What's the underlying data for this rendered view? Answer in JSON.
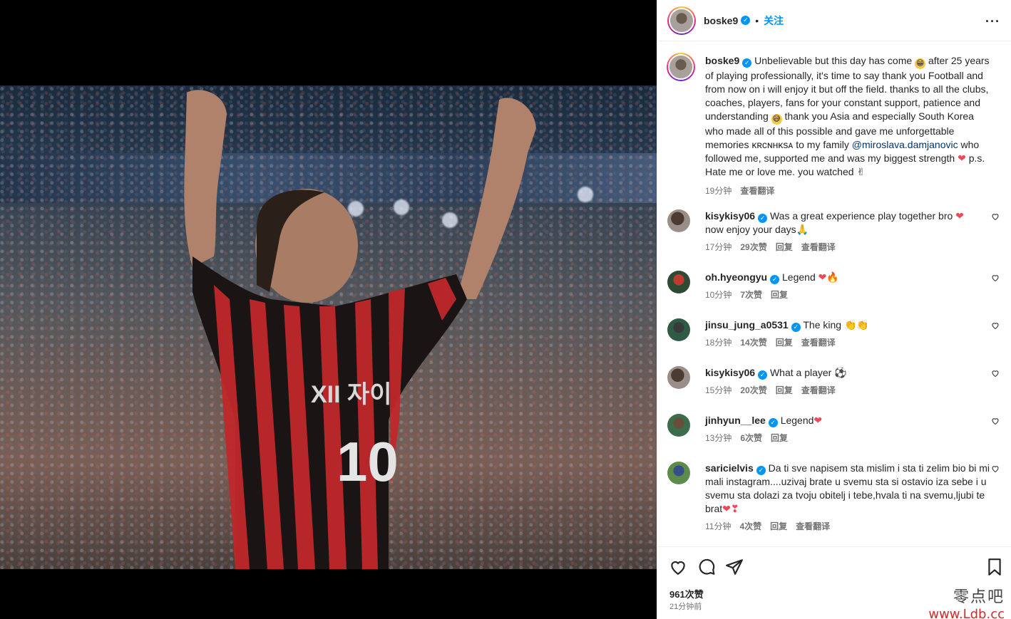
{
  "post": {
    "username": "boske9",
    "follow_label": "关注",
    "caption": {
      "text_1": "Unbelievable but this day has come",
      "text_2": "after 25 years of playing professionally, it's time to say thank you Football and from now on i will enjoy it but off the field. thanks to all the clubs, coaches, players, fans for your constant support, patience and understanding",
      "text_3": "thank you Asia and especially South Korea who made all of this possible and gave me unforgettable memories ᴋʀᴄɴʜᴋsᴀ to my family",
      "mention": "@miroslava.damjanovic",
      "text_4": "who followed me, supported me and was my biggest strength",
      "text_5": "p.s. Hate me or love me. you watched",
      "time": "19分钟",
      "translate": "查看翻译"
    }
  },
  "comments": [
    {
      "user": "kisykisy06",
      "text": "Was a great experience play together bro",
      "text2": "now enjoy your days",
      "time": "17分钟",
      "likes": "29次赞",
      "reply": "回复",
      "translate": "查看翻译"
    },
    {
      "user": "oh.hyeongyu",
      "text": "Legend",
      "time": "10分钟",
      "likes": "7次赞",
      "reply": "回复"
    },
    {
      "user": "jinsu_jung_a0531",
      "text": "The king",
      "time": "18分钟",
      "likes": "14次赞",
      "reply": "回复",
      "translate": "查看翻译"
    },
    {
      "user": "kisykisy06",
      "text": "What a player",
      "time": "15分钟",
      "likes": "20次赞",
      "reply": "回复",
      "translate": "查看翻译"
    },
    {
      "user": "jinhyun__lee",
      "text": "Legend",
      "time": "13分钟",
      "likes": "6次赞",
      "reply": "回复"
    },
    {
      "user": "saricielvis",
      "text": "Da ti sve napisem sta mislim i sta ti zelim bio bi mi mali instagram....uzivaj brate u svemu sta si ostavio iza sebe i u svemu sta dolazi za tvoju obitelj i tebe,hvala ti na svemu,ljubi te brat",
      "time": "11分钟",
      "likes": "4次赞",
      "reply": "回复",
      "translate": "查看翻译"
    }
  ],
  "footer": {
    "likes": "961次赞",
    "posted": "21分钟前"
  },
  "watermark": {
    "cn": "零点吧",
    "url": "www.Ldb.cc"
  },
  "jersey": {
    "sponsor": "XII 자이",
    "number": "10"
  },
  "colors": {
    "accent": "#0095f6",
    "mention": "#00376b",
    "meta": "#737373",
    "heart": "#ed4956"
  },
  "icons": [
    "verified-icon",
    "more-icon",
    "heart-icon",
    "comment-icon",
    "share-icon",
    "bookmark-icon"
  ]
}
